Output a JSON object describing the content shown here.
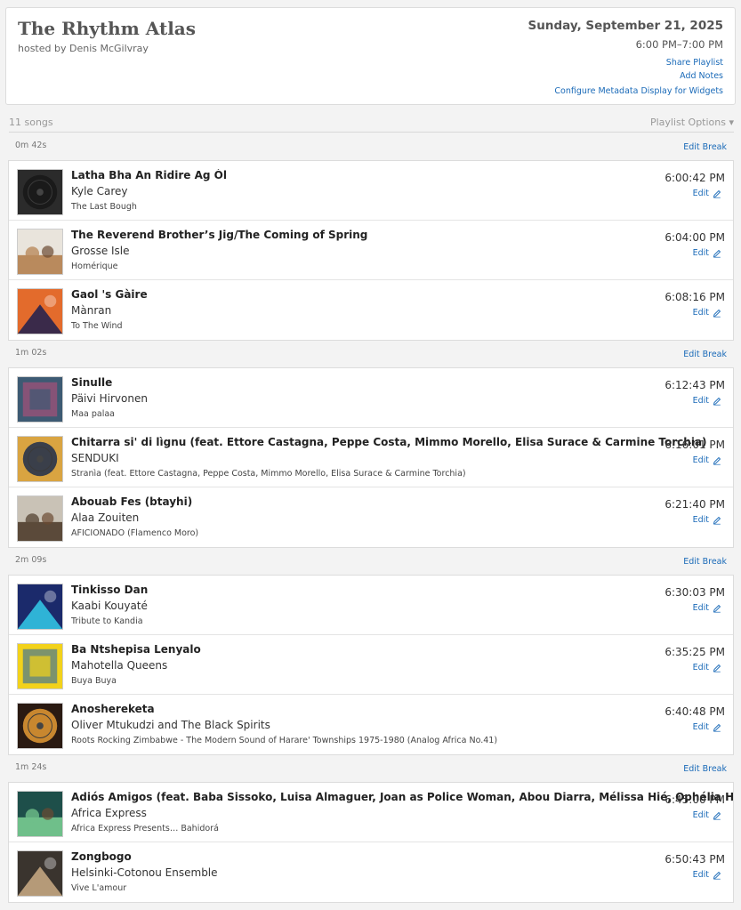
{
  "header": {
    "title": "The Rhythm Atlas",
    "host": "hosted by Denis McGilvray",
    "date": "Sunday, September 21, 2025",
    "time_range": "6:00 PM–7:00 PM",
    "share_link": "Share Playlist",
    "notes_link": "Add Notes",
    "metadata_link": "Configure Metadata Display for Widgets"
  },
  "toolbar": {
    "song_count": "11 songs",
    "options_label": "Playlist Options ▾"
  },
  "edit_label": "Edit",
  "edit_break_label": "Edit Break",
  "breaks": [
    {
      "duration": "0m 42s"
    },
    {
      "duration": "1m 02s"
    },
    {
      "duration": "2m 09s"
    },
    {
      "duration": "1m 24s"
    }
  ],
  "groups": [
    {
      "tracks": [
        {
          "title": "Latha Bha An Ridire Ag Òl",
          "artist": "Kyle Carey",
          "album": "The Last Bough",
          "time": "6:00:42 PM",
          "art_colors": [
            "#2b2b2b",
            "#1a1a1a"
          ]
        },
        {
          "title": "The Reverend Brother’s Jig/The Coming of Spring",
          "artist": "Grosse Isle",
          "album": "Homérique",
          "time": "6:04:00 PM",
          "art_colors": [
            "#e9e4dc",
            "#b98a5d"
          ]
        },
        {
          "title": "Gaol 's Gàire",
          "artist": "Mànran",
          "album": "To The Wind",
          "time": "6:08:16 PM",
          "art_colors": [
            "#e36b2c",
            "#3a2a4a"
          ]
        }
      ]
    },
    {
      "tracks": [
        {
          "title": "Sinulle",
          "artist": "Päivi Hirvonen",
          "album": "Maa palaa",
          "time": "6:12:43 PM",
          "art_colors": [
            "#3d5a73",
            "#c24e7a"
          ]
        },
        {
          "title": "Chitarra si' di lìgnu (feat. Ettore Castagna, Peppe Costa, Mimmo Morello, Elisa Surace & Carmine Torchia)",
          "artist": "SENDUKI",
          "album": "Stranìa (feat. Ettore Castagna, Peppe Costa, Mimmo Morello, Elisa Surace & Carmine Torchia)",
          "time": "6:16:01 PM",
          "art_colors": [
            "#d9a441",
            "#3a3f4a"
          ]
        },
        {
          "title": "Abouab Fes (btayhi)",
          "artist": "Alaa Zouiten",
          "album": "AFICIONADO (Flamenco Moro)",
          "time": "6:21:40 PM",
          "art_colors": [
            "#c9c2b6",
            "#5b4a3a"
          ]
        }
      ]
    },
    {
      "tracks": [
        {
          "title": "Tinkisso Dan",
          "artist": "Kaabi Kouyaté",
          "album": "Tribute to Kandia",
          "time": "6:30:03 PM",
          "art_colors": [
            "#1b2a6b",
            "#2fb3d6"
          ]
        },
        {
          "title": "Ba Ntshepisa Lenyalo",
          "artist": "Mahotella Queens",
          "album": "Buya Buya",
          "time": "6:35:25 PM",
          "art_colors": [
            "#f2d21b",
            "#1c5fb0"
          ]
        },
        {
          "title": "Anoshereketa",
          "artist": "Oliver Mtukudzi and The Black Spirits",
          "album": "Roots Rocking Zimbabwe - The Modern Sound of Harare' Townships 1975-1980 (Analog Africa No.41)",
          "time": "6:40:48 PM",
          "art_colors": [
            "#2a1a12",
            "#c8872f"
          ]
        }
      ]
    },
    {
      "tracks": [
        {
          "title": "Adiós Amigos (feat. Baba Sissoko, Luisa Almaguer, Joan as Police Woman, Abou Diarra, Mélissa Hié, Ophélia Hié & Yendé Bala",
          "artist": "Africa Express",
          "album": "Africa Express Presents… Bahidorá",
          "time": "6:45:00 PM",
          "art_colors": [
            "#1e4f4a",
            "#6fbf8a"
          ]
        },
        {
          "title": "Zongbogo",
          "artist": "Helsinki-Cotonou Ensemble",
          "album": "Vive L'amour",
          "time": "6:50:43 PM",
          "art_colors": [
            "#3a342e",
            "#b59a78"
          ]
        }
      ]
    }
  ]
}
